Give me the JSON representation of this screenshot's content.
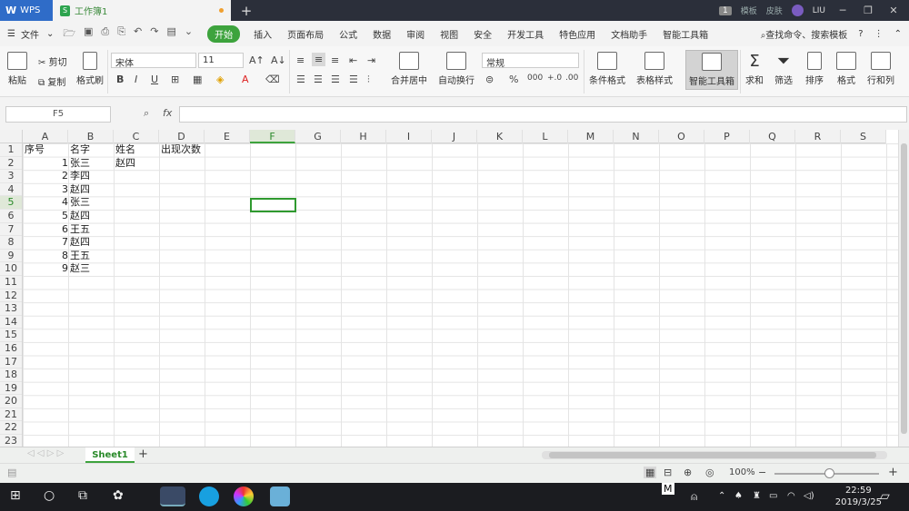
{
  "titlebar": {
    "app_tab": "WPS",
    "doc_tab": "工作簿1",
    "new_tab": "+",
    "badge": "1",
    "template": "模板",
    "skin": "皮肤",
    "user": "LIU"
  },
  "menu": {
    "file": "文件",
    "items": [
      "开始",
      "插入",
      "页面布局",
      "公式",
      "数据",
      "审阅",
      "视图",
      "安全",
      "开发工具",
      "特色应用",
      "文档助手",
      "智能工具箱"
    ],
    "search": "查找命令、搜索模板"
  },
  "ribbon": {
    "paste": "粘贴",
    "cut": "剪切",
    "copy": "复制",
    "format_painter": "格式刷",
    "font": "宋体",
    "size": "11",
    "merge": "合并居中",
    "wrap": "自动换行",
    "number_format": "常规",
    "cond_format": "条件格式",
    "table_style": "表格样式",
    "smart_toolbox": "智能工具箱",
    "sum": "求和",
    "filter": "筛选",
    "sort": "排序",
    "format": "格式",
    "rowcol": "行和列"
  },
  "formula": {
    "cell_ref": "F5",
    "fx": "fx",
    "value": ""
  },
  "columns": [
    "A",
    "B",
    "C",
    "D",
    "E",
    "F",
    "G",
    "H",
    "I",
    "J",
    "K",
    "L",
    "M",
    "N",
    "O",
    "P",
    "Q",
    "R",
    "S"
  ],
  "rows": [
    "1",
    "2",
    "3",
    "4",
    "5",
    "6",
    "7",
    "8",
    "9",
    "10",
    "11",
    "12",
    "13",
    "14",
    "15",
    "16",
    "17",
    "18",
    "19",
    "20",
    "21",
    "22",
    "23"
  ],
  "cells": {
    "A1": "序号",
    "B1": "名字",
    "C1": "姓名",
    "D1": "出现次数",
    "A2": "1",
    "B2": "张三",
    "C2": "赵四",
    "A3": "2",
    "B3": "李四",
    "A4": "3",
    "B4": "赵四",
    "A5": "4",
    "B5": "张三",
    "A6": "5",
    "B6": "赵四",
    "A7": "6",
    "B7": "王五",
    "A8": "7",
    "B8": "赵四",
    "A9": "8",
    "B9": "王五",
    "A10": "9",
    "B10": "赵三"
  },
  "sheet": {
    "tab": "Sheet1",
    "add": "+"
  },
  "status": {
    "zoom": "100%"
  },
  "taskbar": {
    "time": "22:59",
    "date": "2019/3/25",
    "ime": "M"
  },
  "colors": {
    "accent": "#3da33d",
    "wps_blue": "#2f6cc8"
  }
}
